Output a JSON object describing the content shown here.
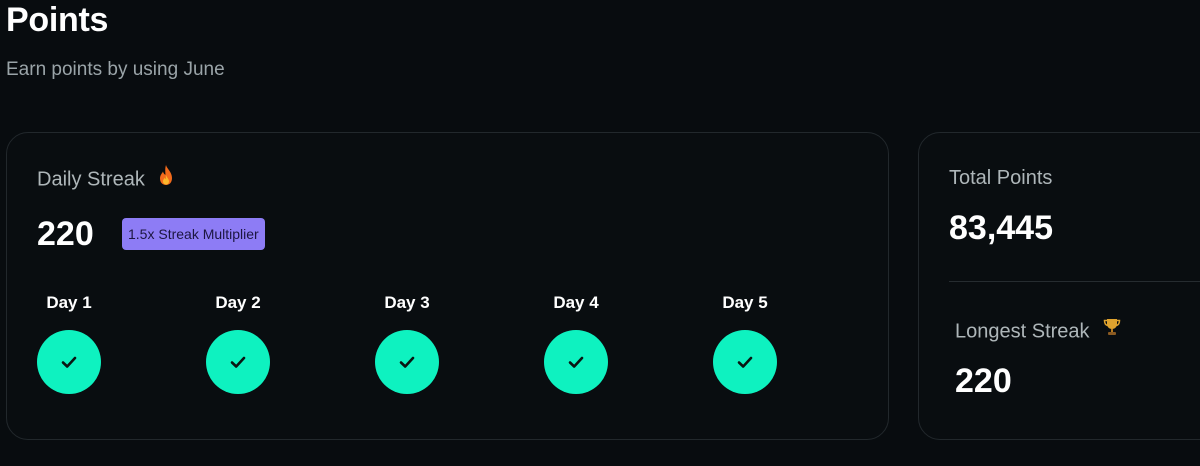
{
  "header": {
    "title": "Points",
    "subtitle": "Earn points by using June"
  },
  "daily_streak": {
    "label": "Daily Streak",
    "icon": "fire-icon",
    "value": "220",
    "multiplier_badge": "1.5x Streak Multiplier",
    "days": [
      {
        "label": "Day 1",
        "completed": true
      },
      {
        "label": "Day 2",
        "completed": true
      },
      {
        "label": "Day 3",
        "completed": true
      },
      {
        "label": "Day 4",
        "completed": true
      },
      {
        "label": "Day 5",
        "completed": true
      }
    ]
  },
  "totals": {
    "total_points_label": "Total Points",
    "total_points_value": "83,445",
    "longest_streak_label": "Longest Streak",
    "longest_streak_icon": "trophy-icon",
    "longest_streak_value": "220"
  },
  "colors": {
    "background": "#080c0f",
    "card_border": "#22282c",
    "check_circle": "#0ef2c0",
    "badge": "#8d7cf5",
    "muted_text": "#aeb6b9"
  }
}
